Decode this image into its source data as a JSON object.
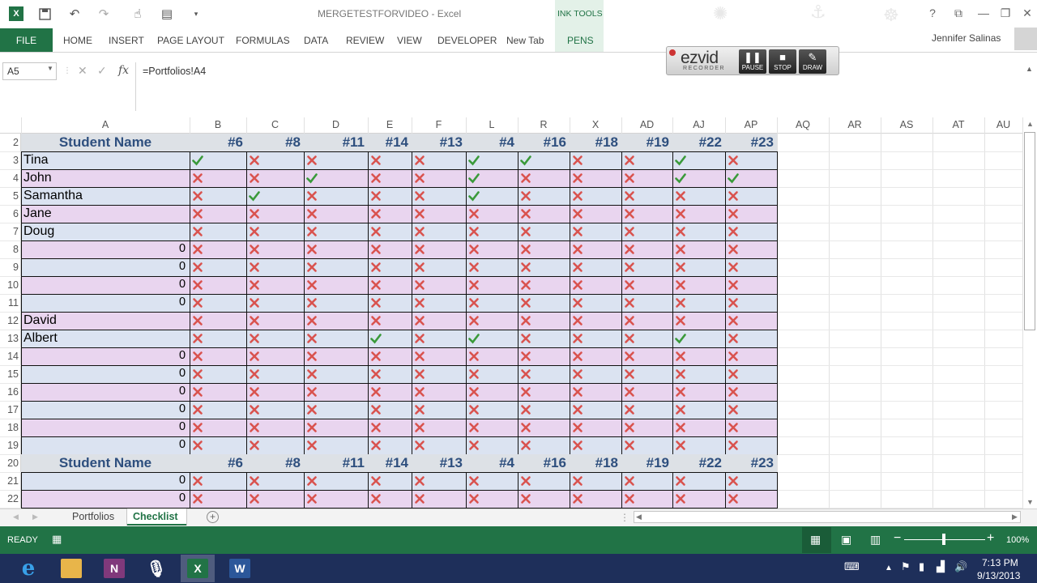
{
  "window": {
    "title": "MERGETESTFORVIDEO - Excel",
    "user": "Jennifer Salinas"
  },
  "ribbon": {
    "file": "FILE",
    "tabs": [
      "HOME",
      "INSERT",
      "PAGE LAYOUT",
      "FORMULAS",
      "DATA",
      "REVIEW",
      "VIEW",
      "DEVELOPER",
      "New Tab"
    ],
    "ink_tools_group": "INK TOOLS",
    "ink_tab": "PENS"
  },
  "ezvid": {
    "logo": "ezvid",
    "sub": "RECORDER",
    "pause": "PAUSE",
    "stop": "STOP",
    "draw": "DRAW"
  },
  "formula_bar": {
    "name_box": "A5",
    "fx": "fx",
    "formula": "=Portfolios!A4"
  },
  "columns": [
    "A",
    "B",
    "C",
    "D",
    "E",
    "F",
    "L",
    "R",
    "X",
    "AD",
    "AJ",
    "AP",
    "AQ",
    "AR",
    "AS",
    "AT",
    "AU"
  ],
  "sheet": {
    "name_header": "Student Name",
    "item_headers": [
      "#6",
      "#8",
      "#11",
      "#14",
      "#13",
      "#4",
      "#16",
      "#18",
      "#19",
      "#22",
      "#23"
    ],
    "rows": [
      {
        "row": "2",
        "type": "header"
      },
      {
        "row": "3",
        "name": "Tina",
        "marks": [
          1,
          0,
          0,
          0,
          0,
          1,
          1,
          0,
          0,
          1,
          0
        ]
      },
      {
        "row": "4",
        "name": "John",
        "marks": [
          0,
          0,
          1,
          0,
          0,
          1,
          0,
          0,
          0,
          1,
          1
        ]
      },
      {
        "row": "5",
        "name": "Samantha",
        "marks": [
          0,
          1,
          0,
          0,
          0,
          1,
          0,
          0,
          0,
          0,
          0
        ]
      },
      {
        "row": "6",
        "name": "Jane",
        "marks": [
          0,
          0,
          0,
          0,
          0,
          0,
          0,
          0,
          0,
          0,
          0
        ]
      },
      {
        "row": "7",
        "name": "Doug",
        "marks": [
          0,
          0,
          0,
          0,
          0,
          0,
          0,
          0,
          0,
          0,
          0
        ]
      },
      {
        "row": "8",
        "name": "0",
        "marks": [
          0,
          0,
          0,
          0,
          0,
          0,
          0,
          0,
          0,
          0,
          0
        ]
      },
      {
        "row": "9",
        "name": "0",
        "marks": [
          0,
          0,
          0,
          0,
          0,
          0,
          0,
          0,
          0,
          0,
          0
        ]
      },
      {
        "row": "10",
        "name": "0",
        "marks": [
          0,
          0,
          0,
          0,
          0,
          0,
          0,
          0,
          0,
          0,
          0
        ]
      },
      {
        "row": "11",
        "name": "0",
        "marks": [
          0,
          0,
          0,
          0,
          0,
          0,
          0,
          0,
          0,
          0,
          0
        ]
      },
      {
        "row": "12",
        "name": "David",
        "marks": [
          0,
          0,
          0,
          0,
          0,
          0,
          0,
          0,
          0,
          0,
          0
        ]
      },
      {
        "row": "13",
        "name": "Albert",
        "marks": [
          0,
          0,
          0,
          1,
          0,
          1,
          0,
          0,
          0,
          1,
          0
        ]
      },
      {
        "row": "14",
        "name": "0",
        "marks": [
          0,
          0,
          0,
          0,
          0,
          0,
          0,
          0,
          0,
          0,
          0
        ]
      },
      {
        "row": "15",
        "name": "0",
        "marks": [
          0,
          0,
          0,
          0,
          0,
          0,
          0,
          0,
          0,
          0,
          0
        ]
      },
      {
        "row": "16",
        "name": "0",
        "marks": [
          0,
          0,
          0,
          0,
          0,
          0,
          0,
          0,
          0,
          0,
          0
        ]
      },
      {
        "row": "17",
        "name": "0",
        "marks": [
          0,
          0,
          0,
          0,
          0,
          0,
          0,
          0,
          0,
          0,
          0
        ]
      },
      {
        "row": "18",
        "name": "0",
        "marks": [
          0,
          0,
          0,
          0,
          0,
          0,
          0,
          0,
          0,
          0,
          0
        ]
      },
      {
        "row": "19",
        "name": "0",
        "marks": [
          0,
          0,
          0,
          0,
          0,
          0,
          0,
          0,
          0,
          0,
          0
        ]
      },
      {
        "row": "20",
        "type": "header"
      },
      {
        "row": "21",
        "name": "0",
        "marks": [
          0,
          0,
          0,
          0,
          0,
          0,
          0,
          0,
          0,
          0,
          0
        ]
      },
      {
        "row": "22",
        "name": "0",
        "marks": [
          0,
          0,
          0,
          0,
          0,
          0,
          0,
          0,
          0,
          0,
          0
        ]
      }
    ]
  },
  "sheet_tabs": [
    "Portfolios",
    "Checklist"
  ],
  "active_sheet": "Checklist",
  "status": {
    "ready": "READY",
    "zoom": "100%",
    "zoom_minus": "−",
    "zoom_plus": "+"
  },
  "clock": {
    "time": "7:13 PM",
    "date": "9/13/2013"
  },
  "colors": {
    "excel_green": "#217346",
    "header_text": "#2e4f7e",
    "check": "#3a9a3a",
    "cross": "#d9534f",
    "row_blue": "#dbe3f1",
    "row_pink": "#e9d5ef",
    "header_fill": "#dde1e6"
  }
}
